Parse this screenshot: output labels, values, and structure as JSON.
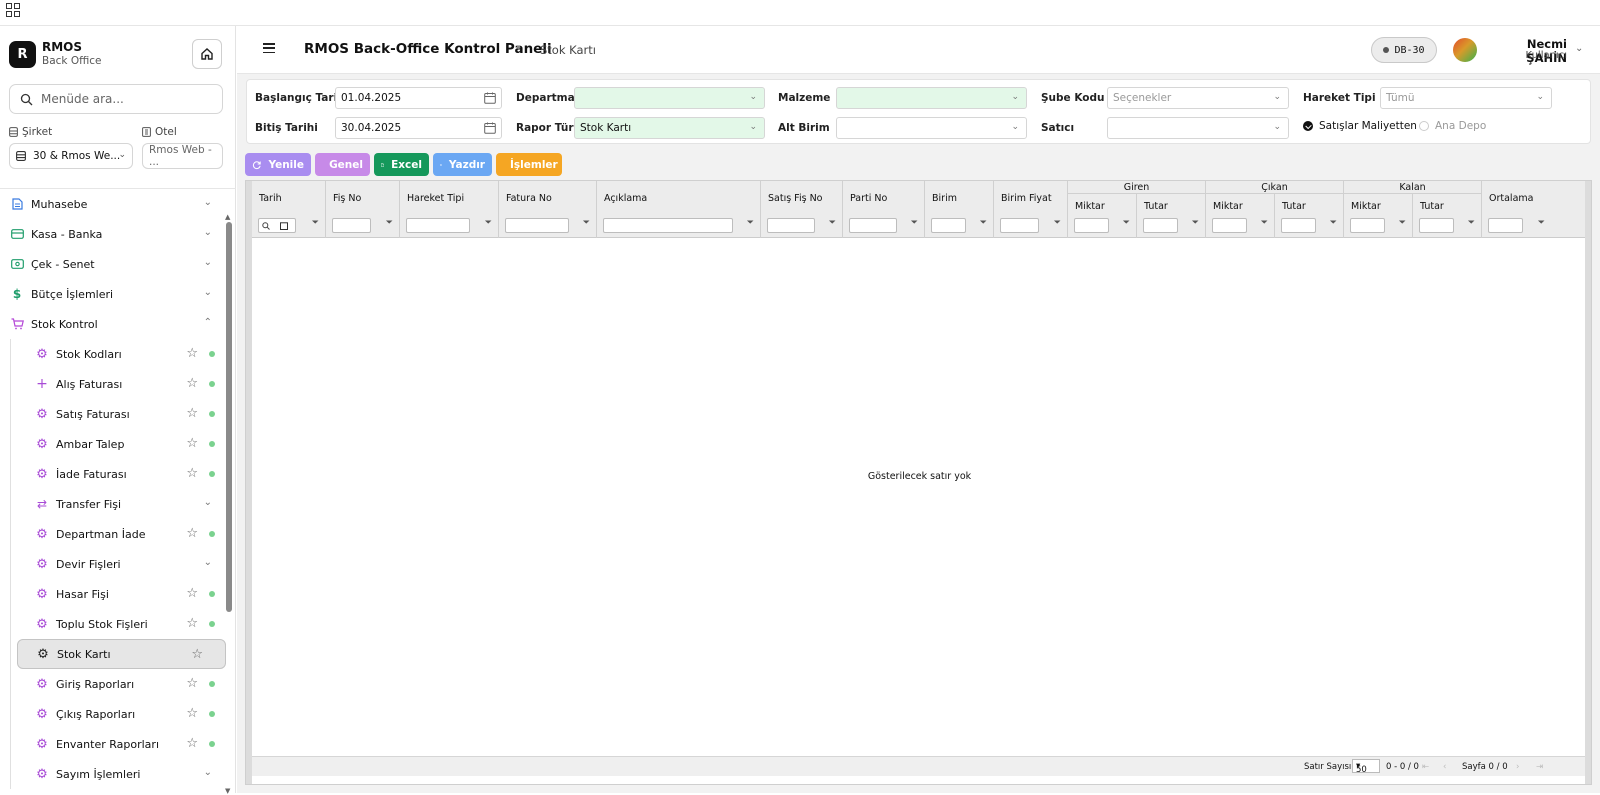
{
  "brand": {
    "initial": "R",
    "name": "RMOS",
    "subtitle": "Back Office"
  },
  "sidebar": {
    "search_placeholder": "Menüde ara...",
    "company_label": "Şirket",
    "company_value": "30 & Rmos We...",
    "hotel_label": "Otel",
    "hotel_value": "Rmos Web - ...",
    "menu": [
      {
        "label": "Muhasebe"
      },
      {
        "label": "Kasa - Banka"
      },
      {
        "label": "Çek - Senet"
      },
      {
        "label": "Bütçe İşlemleri"
      },
      {
        "label": "Stok Kontrol"
      }
    ],
    "sub": [
      {
        "label": "Stok Kodları"
      },
      {
        "label": "Alış Faturası"
      },
      {
        "label": "Satış Faturası"
      },
      {
        "label": "Ambar Talep"
      },
      {
        "label": "İade Faturası"
      },
      {
        "label": "Transfer Fişi"
      },
      {
        "label": "Departman İade"
      },
      {
        "label": "Devir Fişleri"
      },
      {
        "label": "Hasar Fişi"
      },
      {
        "label": "Toplu Stok Fişleri"
      },
      {
        "label": "Stok Kartı"
      },
      {
        "label": "Giriş Raporları"
      },
      {
        "label": "Çıkış Raporları"
      },
      {
        "label": "Envanter Raporları"
      },
      {
        "label": "Sayım İşlemleri"
      }
    ]
  },
  "header": {
    "title": "RMOS Back-Office Kontrol Paneli",
    "separator": "•",
    "page": "Stok Kartı",
    "db": "DB-30",
    "user_name": "Necmi ŞAHİN",
    "user_role": "Kullanıcı"
  },
  "filters": {
    "start_label": "Başlangıç Tarihi",
    "start_value": "01.04.2025",
    "end_label": "Bitiş Tarihi",
    "end_value": "30.04.2025",
    "dept_label": "Departman",
    "dept_value": "",
    "report_label": "Rapor Türü",
    "report_value": "Stok Kartı",
    "material_label": "Malzeme",
    "material_value": "",
    "subunit_label": "Alt Birim",
    "subunit_value": "",
    "branch_label": "Şube Kodu",
    "branch_placeholder": "Seçenekler",
    "seller_label": "Satıcı",
    "seller_value": "",
    "movement_label": "Hareket Tipi",
    "movement_placeholder": "Tümü",
    "radio1": "Satışlar Maliyetten",
    "radio2": "Ana Depo"
  },
  "toolbar": {
    "refresh": "Yenile",
    "general": "Genel",
    "excel": "Excel",
    "print": "Yazdır",
    "actions": "İşlemler"
  },
  "colors": {
    "refresh": "#a98df0",
    "general": "#c78ae8",
    "excel": "#15985b",
    "print": "#6aa7f3",
    "actions": "#f5a623"
  },
  "grid": {
    "columns": [
      "Tarih",
      "Fiş No",
      "Hareket Tipi",
      "Fatura No",
      "Açıklama",
      "Satış Fiş No",
      "Parti No",
      "Birim",
      "Birim Fiyat",
      "Ortalama"
    ],
    "groups": [
      "Giren",
      "Çıkan",
      "Kalan"
    ],
    "subcols": [
      "Miktar",
      "Tutar"
    ],
    "empty": "Gösterilecek satır yok",
    "footer": {
      "rows_label": "Satır Sayısı:",
      "rows_value": "50",
      "range": "0 - 0 / 0",
      "page": "Sayfa 0 / 0"
    }
  }
}
